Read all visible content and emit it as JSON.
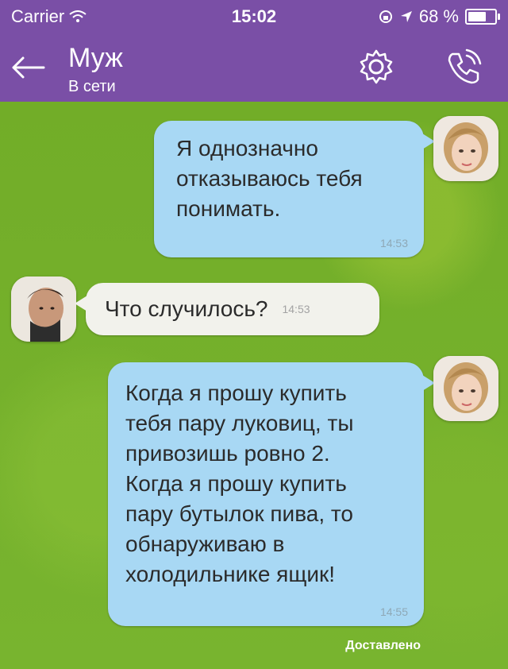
{
  "status": {
    "carrier": "Carrier",
    "time": "15:02",
    "battery": "68 %",
    "battery_level": 0.68
  },
  "header": {
    "title": "Муж",
    "subtitle": "В сети"
  },
  "messages": [
    {
      "direction": "outgoing",
      "text": "Я однозначно\nотказываюсь тебя\nпонимать.",
      "time": "14:53"
    },
    {
      "direction": "incoming",
      "text": "Что случилось?",
      "time": "14:53"
    },
    {
      "direction": "outgoing",
      "text": "Когда я прошу купить\nтебя пару луковиц, ты\nпривозишь ровно 2.\nКогда я прошу купить\nпару бутылок пива, то\nобнаруживаю в\nхолодильнике ящик!",
      "time": "14:55"
    }
  ],
  "delivered_label": "Доставлено",
  "colors": {
    "header": "#7a4fa6",
    "outgoing_bubble": "#a8d8f4",
    "incoming_bubble": "#f2f2ec",
    "background": "#6fae26"
  },
  "icons": [
    "back-arrow-icon",
    "gear-icon",
    "phone-call-icon",
    "wifi-icon",
    "lock-rotation-icon",
    "location-arrow-icon",
    "battery-icon"
  ]
}
